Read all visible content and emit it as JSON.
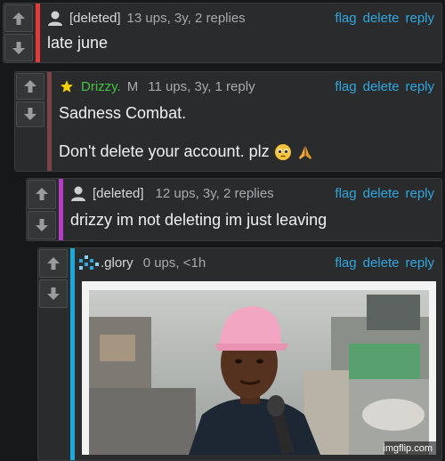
{
  "comments": [
    {
      "user": "[deleted]",
      "stats": "13 ups, 3y, 2 replies",
      "text": "late june",
      "bar_color": "#e23a3a"
    },
    {
      "user": "Drizzy.",
      "badge": "M",
      "stats": "11 ups, 3y, 1 reply",
      "text_lines": [
        "Sadness Combat.",
        "Don't delete your account. plz"
      ],
      "bar_color": "#7a4446"
    },
    {
      "user": "[deleted]",
      "stats": "12 ups, 3y, 2 replies",
      "text": "drizzy im not deleting im just leaving",
      "bar_color": "#b43cc8"
    },
    {
      "user": ".glory",
      "stats": "0 ups, <1h",
      "bar_color": "#1ea9dc",
      "image_watermark": "imgflip.com"
    }
  ],
  "actions": {
    "flag": "flag",
    "delete": "delete",
    "reply": "reply"
  },
  "icons": [
    "upvote-arrow-icon",
    "downvote-arrow-icon",
    "user-avatar-icon",
    "star-icon",
    "pleading-face-emoji",
    "praying-hands-emoji",
    "pixel-avatar-icon"
  ]
}
